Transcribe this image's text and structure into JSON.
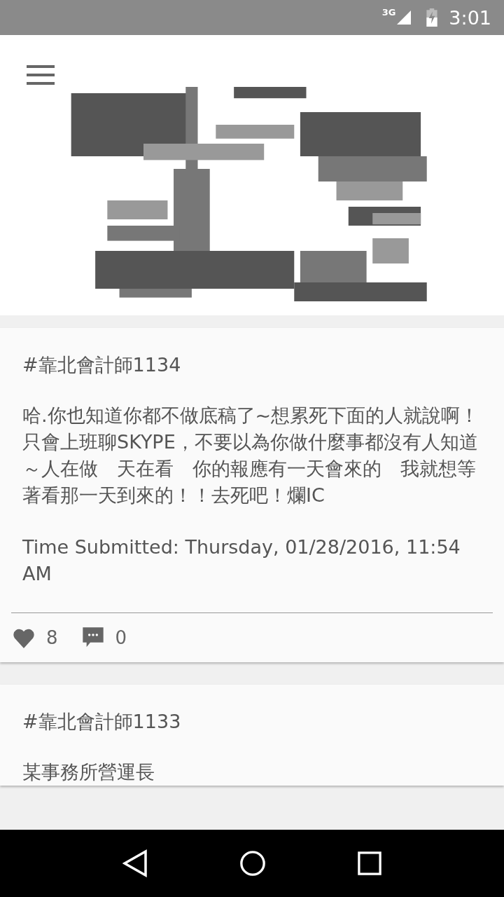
{
  "status_bar": {
    "network": "3G",
    "time": "3:01"
  },
  "posts": [
    {
      "title": "#靠北會計師1134",
      "body": "哈.你也知道你都不做底稿了~想累死下面的人就說啊！只會上班聊SKYPE，不要以為你做什麼事都沒有人知道～人在做　天在看　你的報應有一天會來的　我就想等著看那一天到來的！！去死吧！爛IC",
      "time_submitted": "Time Submitted:  Thursday, 01/28/2016, 11:54 AM",
      "likes": "8",
      "comments": "0"
    },
    {
      "title": "#靠北會計師1133",
      "body": "某事務所營運長"
    }
  ]
}
